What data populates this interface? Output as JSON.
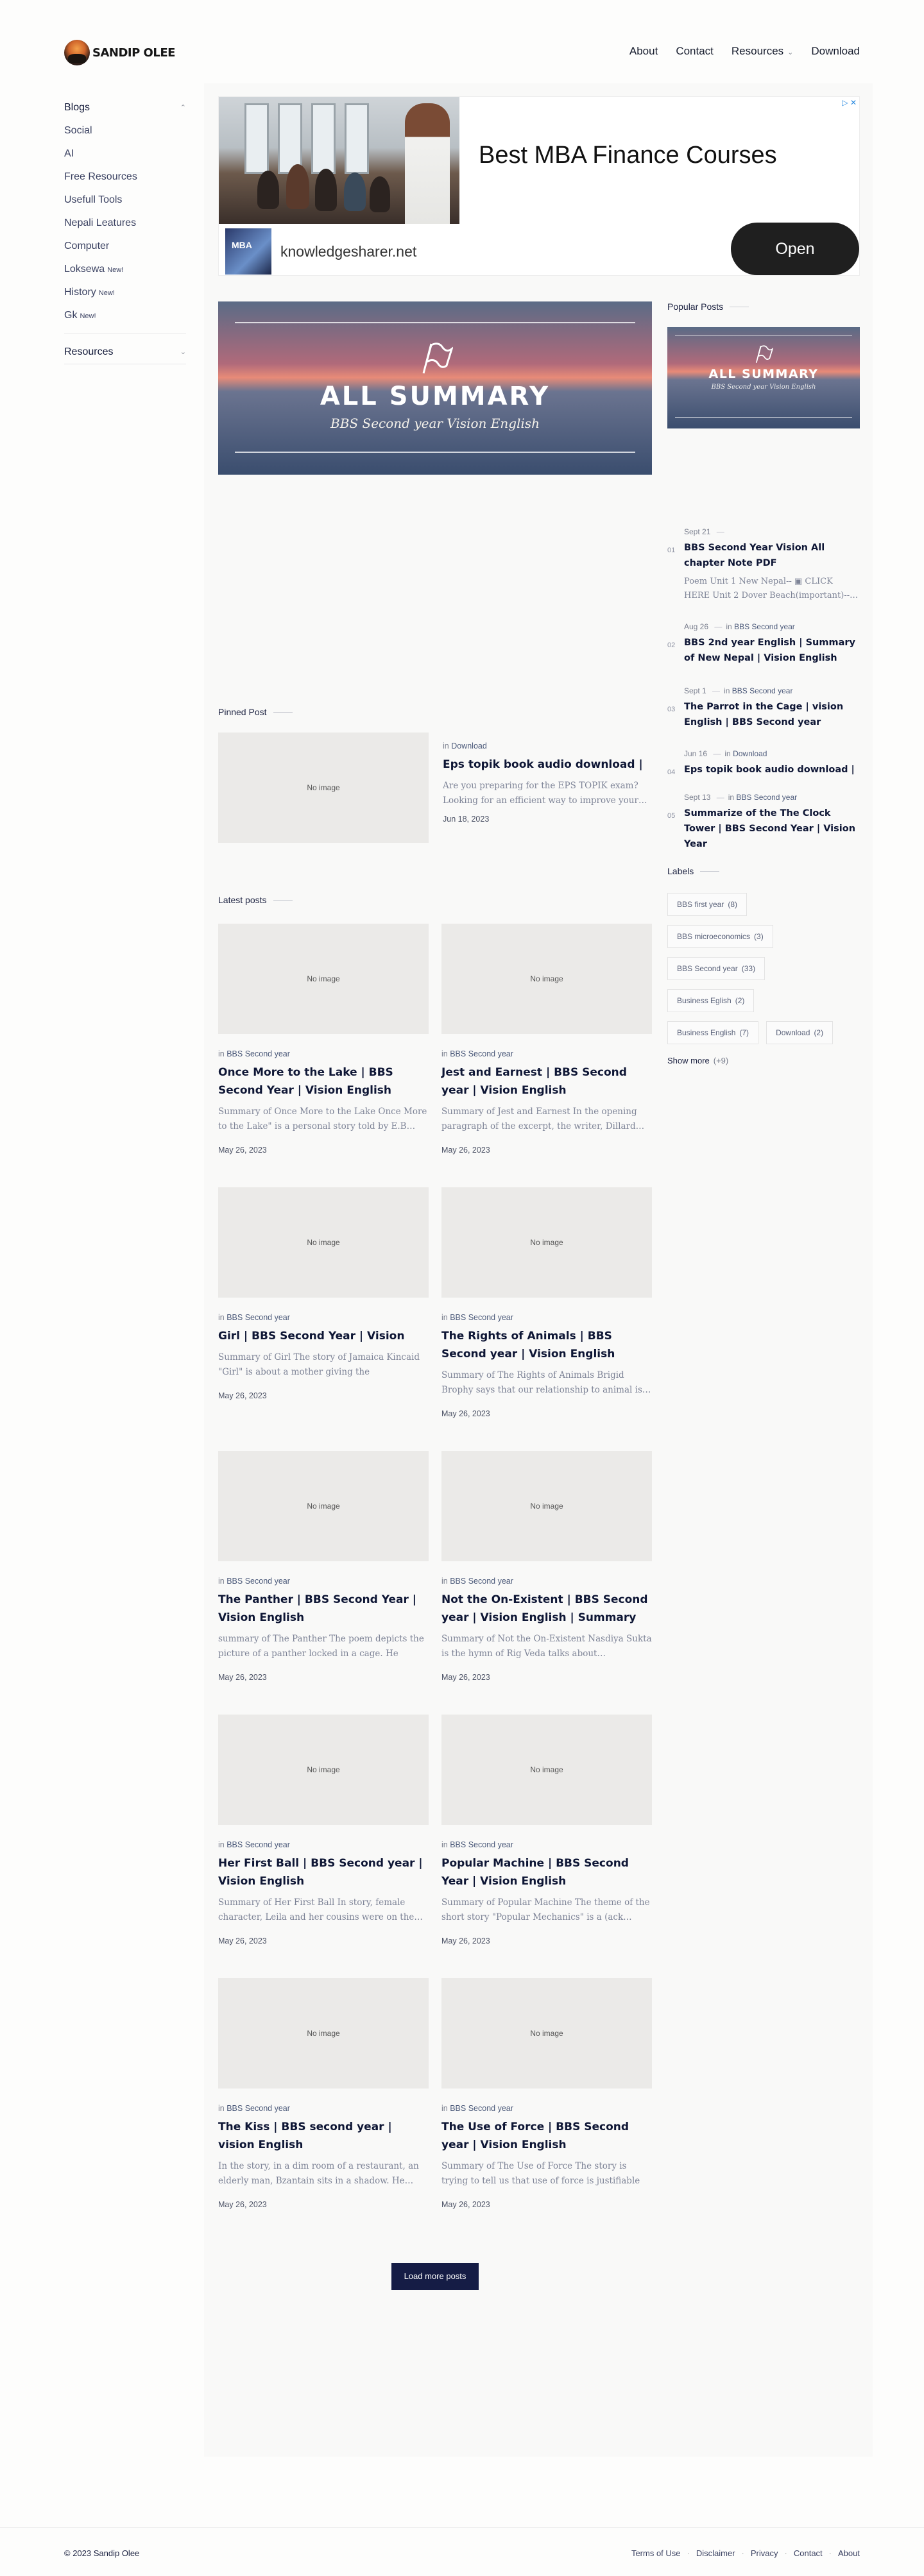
{
  "header": {
    "logo_text": "SANDIP OLEE",
    "nav": [
      {
        "label": "About"
      },
      {
        "label": "Contact"
      },
      {
        "label": "Resources"
      },
      {
        "label": "Download"
      }
    ]
  },
  "sidebar": {
    "blogs_label": "Blogs",
    "items": [
      {
        "label": "Social",
        "new": ""
      },
      {
        "label": "AI",
        "new": ""
      },
      {
        "label": "Free Resources",
        "new": ""
      },
      {
        "label": "Usefull Tools",
        "new": ""
      },
      {
        "label": "Nepali Leatures",
        "new": ""
      },
      {
        "label": "Computer",
        "new": ""
      },
      {
        "label": "Loksewa",
        "new": "New!"
      },
      {
        "label": "History",
        "new": "New!"
      },
      {
        "label": "Gk",
        "new": "New!"
      }
    ],
    "resources_label": "Resources"
  },
  "ad": {
    "headline": "Best MBA Finance Courses",
    "logo_text": "MBA",
    "domain": "knowledgesharer.net",
    "cta": "Open",
    "adchoice": "▷ ✕"
  },
  "hero": {
    "title": "ALL SUMMARY",
    "subtitle": "BBS Second year Vision English"
  },
  "pinned": {
    "section_title": "Pinned Post",
    "no_image": "No image",
    "in": "in",
    "category": "Download",
    "title": "Eps topik book audio download |",
    "excerpt": "Are you preparing for the EPS TOPIK exam? Looking for an efficient way to improve your…",
    "date": "Jun 18, 2023"
  },
  "latest": {
    "section_title": "Latest posts",
    "no_image": "No image",
    "in": "in",
    "posts": [
      {
        "category": "BBS Second year",
        "title": "Once More to the Lake | BBS Second Year | Vision English",
        "excerpt": "Summary of  Once More to the Lake Once More to the Lake\" is a personal story told by E.B…",
        "date": "May 26, 2023"
      },
      {
        "category": "BBS Second year",
        "title": "Jest and Earnest | BBS Second year | Vision English",
        "excerpt": "Summary of Jest and Earnest In the opening paragraph of the excerpt, the writer, Dillard…",
        "date": "May 26, 2023"
      },
      {
        "category": "BBS Second year",
        "title": "Girl | BBS Second Year | Vision",
        "excerpt": "Summary of Girl  The story of Jamaica Kincaid \"Girl\" is about a mother giving the instruction…",
        "date": "May 26, 2023"
      },
      {
        "category": "BBS Second year",
        "title": "The Rights of Animals | BBS Second year | Vision English",
        "excerpt": "Summary of The Rights of Animals Brigid Brophy says that our relationship to animal is…",
        "date": "May 26, 2023"
      },
      {
        "category": "BBS Second year",
        "title": "The Panther | BBS Second Year | Vision English",
        "excerpt": "summary of The Panther The poem depicts the picture of a panther locked in a cage. He hopes…",
        "date": "May 26, 2023"
      },
      {
        "category": "BBS Second year",
        "title": "Not the On-Existent | BBS Second year | Vision English | Summary",
        "excerpt": "Summary of  Not the On-Existent Nasdiya Sukta is the hymn of Rig Veda talks about…",
        "date": "May 26, 2023"
      },
      {
        "category": "BBS Second year",
        "title": "Her First Ball | BBS Second year | Vision English",
        "excerpt": "Summary of Her First Ball  In story, female character, Leila and her cousins were on the…",
        "date": "May 26, 2023"
      },
      {
        "category": "BBS Second year",
        "title": "Popular Machine | BBS Second Year | Vision English",
        "excerpt": "Summary of  Popular Machine The theme of the short story \"Popular Mechanics\" is a (ack…",
        "date": "May 26, 2023"
      },
      {
        "category": "BBS Second year",
        "title": "The Kiss | BBS second year | vision English",
        "excerpt": "In the story, in a dim room of a restaurant, an elderly man, Bzantain sits in a shadow. He…",
        "date": "May 26, 2023"
      },
      {
        "category": "BBS Second year",
        "title": "The Use of Force | BBS Second year | Vision English",
        "excerpt": "Summary of  The Use of Force The story is trying to tell us that use of force is justifiable i…",
        "date": "May 26, 2023"
      }
    ],
    "load_more": "Load more posts"
  },
  "popular": {
    "section_title": "Popular Posts",
    "image_title": "ALL SUMMARY",
    "image_subtitle": "BBS Second year Vision English",
    "in": "in",
    "posts": [
      {
        "num": "01",
        "date": "Sept 21",
        "category": "",
        "title": "BBS Second Year Vision All chapter Note PDF",
        "excerpt": "Poem Unit 1 New Nepal-- ▣ CLICK HERE Unit 2 Dover Beach(important)--…"
      },
      {
        "num": "02",
        "date": "Aug 26",
        "category": "BBS Second year",
        "title": "BBS 2nd year English | Summary of New Nepal | Vision English",
        "excerpt": ""
      },
      {
        "num": "03",
        "date": "Sept 1",
        "category": "BBS Second year",
        "title": "The Parrot in the Cage | vision English | BBS Second year",
        "excerpt": ""
      },
      {
        "num": "04",
        "date": "Jun 16",
        "category": "Download",
        "title": "Eps topik book audio download |",
        "excerpt": ""
      },
      {
        "num": "05",
        "date": "Sept 13",
        "category": "BBS Second year",
        "title": "Summarize of the The Clock Tower | BBS Second Year | Vision Year",
        "excerpt": ""
      }
    ]
  },
  "labels": {
    "section_title": "Labels",
    "tags": [
      {
        "name": "BBS first year",
        "count": "(8)"
      },
      {
        "name": "BBS microeconomics",
        "count": "(3)"
      },
      {
        "name": "BBS Second year",
        "count": "(33)"
      },
      {
        "name": "Business Eglish",
        "count": "(2)"
      },
      {
        "name": "Business English",
        "count": "(7)"
      },
      {
        "name": "Download",
        "count": "(2)"
      }
    ],
    "show_more": "Show more",
    "show_more_count": "(+9)"
  },
  "footer": {
    "copyright": "© 2023 Sandip Olee",
    "links": [
      {
        "label": "Terms of Use"
      },
      {
        "label": "Disclaimer"
      },
      {
        "label": "Privacy"
      },
      {
        "label": "Contact"
      },
      {
        "label": "About"
      }
    ]
  }
}
